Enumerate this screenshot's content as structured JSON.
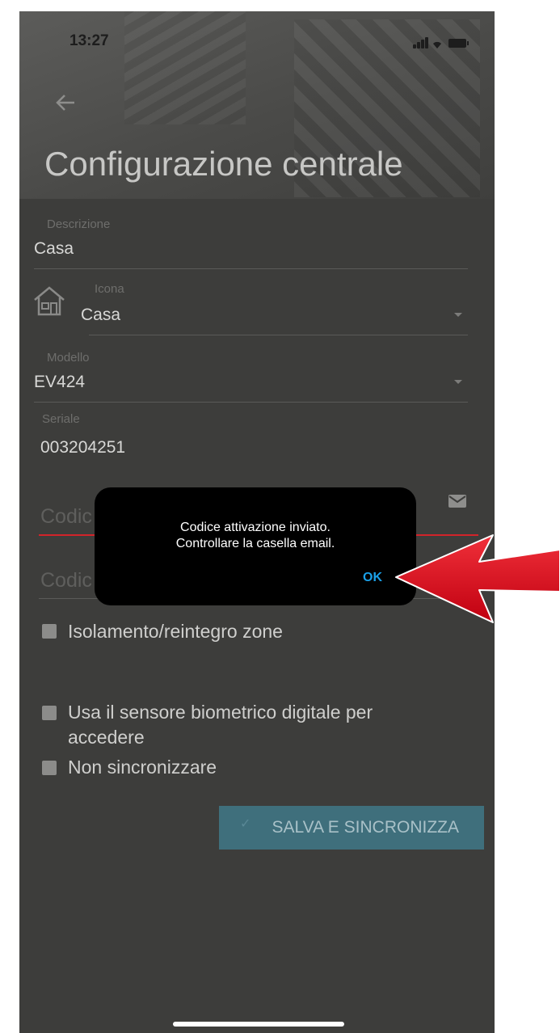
{
  "status_bar": {
    "time": "13:27"
  },
  "header": {
    "title": "Configurazione centrale"
  },
  "form": {
    "descrizione": {
      "label": "Descrizione",
      "value": "Casa"
    },
    "icona": {
      "label": "Icona",
      "value": "Casa",
      "icon": "house-icon"
    },
    "modello": {
      "label": "Modello",
      "value": "EV424"
    },
    "seriale": {
      "label": "Seriale",
      "value": "003204251"
    },
    "codice_attivazione": {
      "placeholder": "Codic"
    },
    "codice_utente": {
      "placeholder": "Codic"
    }
  },
  "options": {
    "isolamento": "Isolamento/reintegro zone",
    "biometrico_line1": "Usa il sensore biometrico digitale per",
    "biometrico_line2": "accedere",
    "non_sincronizzare": "Non sincronizzare"
  },
  "actions": {
    "save_label": "SALVA E SINCRONIZZA"
  },
  "dialog": {
    "line1": "Codice attivazione inviato.",
    "line2": "Controllare la casella email.",
    "ok_label": "OK"
  },
  "colors": {
    "background": "#3d3d3b",
    "accent_error": "#d2232a",
    "button": "#3f6f7c",
    "dialog_ok": "#1aa0e8",
    "annotation_arrow": "#e00012"
  }
}
